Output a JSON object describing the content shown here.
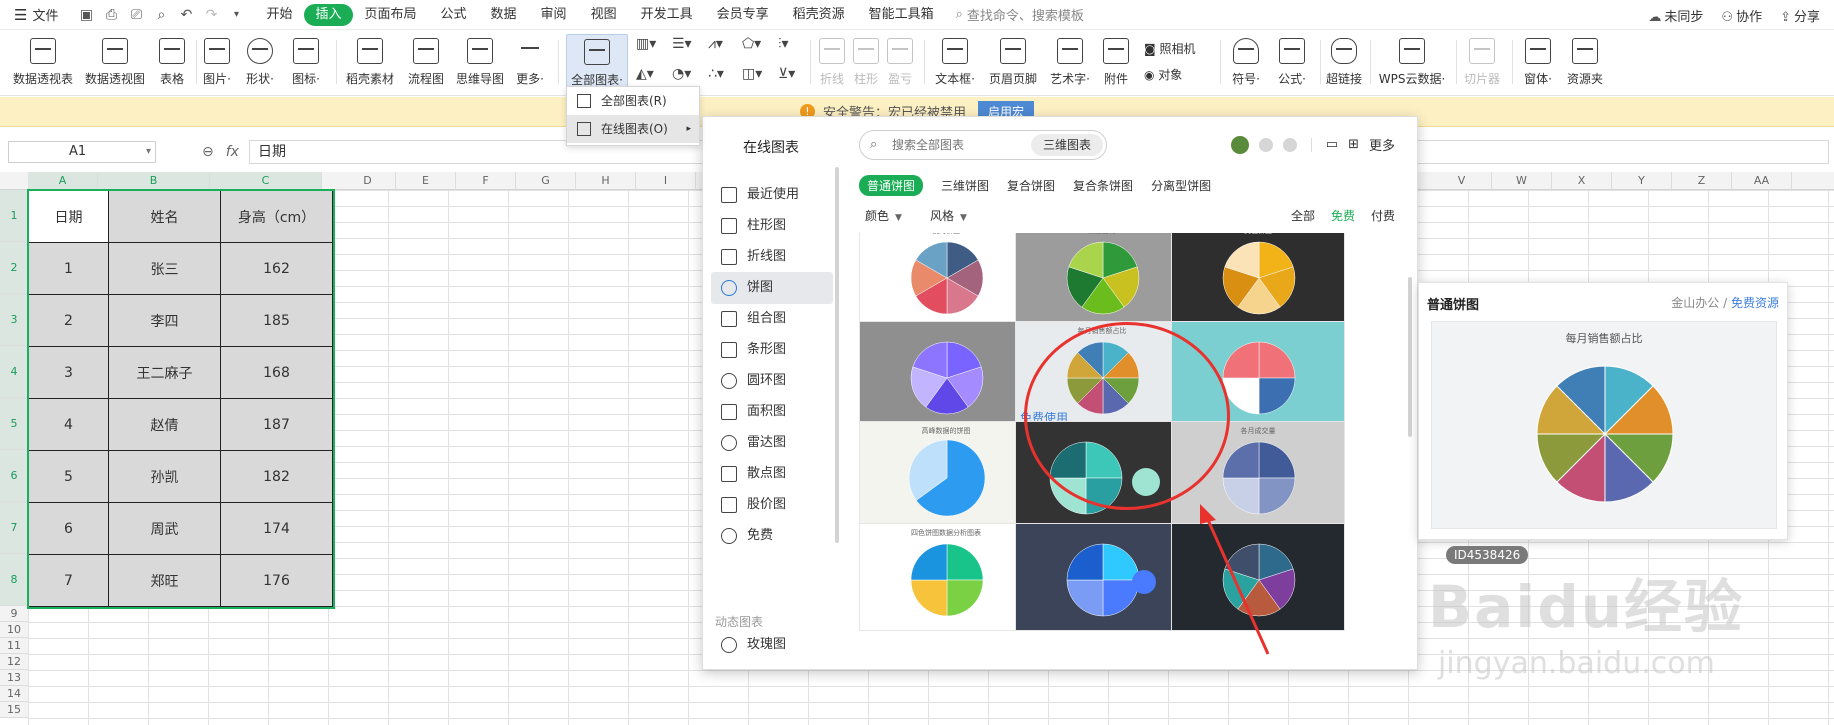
{
  "menubar": {
    "file": "文件",
    "tabs": [
      "开始",
      "插入",
      "页面布局",
      "公式",
      "数据",
      "审阅",
      "视图",
      "开发工具",
      "会员专享",
      "稻壳资源",
      "智能工具箱"
    ],
    "active_tab": "插入",
    "search": "查找命令、搜索模板",
    "sync": "未同步",
    "collab": "协作",
    "share": "分享"
  },
  "ribbon": {
    "pivot_table": "数据透视表",
    "pivot_chart": "数据透视图",
    "table": "表格",
    "picture": "图片·",
    "shape": "形状·",
    "icon": "图标·",
    "docer": "稻壳素材",
    "flowchart": "流程图",
    "mindmap": "思维导图",
    "more": "更多·",
    "all_charts": "全部图表·",
    "spark_line": "折线",
    "spark_bar": "柱形",
    "spark_winloss": "盈亏",
    "textbox": "文本框·",
    "header_footer": "页眉页脚",
    "wordart": "艺术字·",
    "attachment": "附件",
    "camera": "照相机",
    "object": "对象",
    "symbol": "符号·",
    "formula": "公式·",
    "hyperlink": "超链接",
    "wps_cloud": "WPS云数据·",
    "slicer": "切片器",
    "window": "窗体·",
    "resources": "资源夹"
  },
  "warning": {
    "text": "安全警告：宏已经被禁用",
    "button": "启用宏"
  },
  "formula_bar": {
    "cell_ref": "A1",
    "fx": "fx",
    "value": "日期"
  },
  "sheet": {
    "columns": [
      "A",
      "B",
      "C",
      "D",
      "E",
      "F",
      "G",
      "H",
      "I",
      "V",
      "W",
      "X",
      "Y",
      "Z",
      "AA"
    ],
    "rows": [
      "1",
      "2",
      "3",
      "4",
      "5",
      "6",
      "7",
      "8",
      "9",
      "10",
      "11",
      "12",
      "13",
      "14",
      "15"
    ],
    "table": {
      "headers": [
        "日期",
        "姓名",
        "身高（cm）"
      ],
      "rows": [
        [
          "1",
          "张三",
          "162"
        ],
        [
          "2",
          "李四",
          "185"
        ],
        [
          "3",
          "王二麻子",
          "168"
        ],
        [
          "4",
          "赵倩",
          "187"
        ],
        [
          "5",
          "孙凯",
          "182"
        ],
        [
          "6",
          "周武",
          "174"
        ],
        [
          "7",
          "郑旺",
          "176"
        ]
      ]
    }
  },
  "dropdown": {
    "items": [
      "全部图表(R)",
      "在线图表(O)"
    ]
  },
  "online_panel": {
    "title": "在线图表",
    "search_placeholder": "搜索全部图表",
    "three_d": "三维图表",
    "more": "更多",
    "sidebar": [
      "最近使用",
      "柱形图",
      "折线图",
      "饼图",
      "组合图",
      "条形图",
      "圆环图",
      "面积图",
      "雷达图",
      "散点图",
      "股价图",
      "免费"
    ],
    "sidebar_active": "饼图",
    "sidebar_section": "动态图表",
    "sidebar_extra": "玫瑰图",
    "chips": [
      "普通饼图",
      "三维饼图",
      "复合饼图",
      "复合条饼图",
      "分离型饼图"
    ],
    "chip_active": "普通饼图",
    "filters": {
      "color": "颜色",
      "style": "风格"
    },
    "price": [
      "全部",
      "免费",
      "付费"
    ],
    "price_active": "免费",
    "free_badge": "免费使用",
    "thumb_titles": [
      "我的饼图",
      "数量占比",
      "黄色饼图",
      "",
      "每月销售额占比",
      "",
      "高峰数据的饼图",
      "",
      "各月成交量",
      "四色饼图数据分析图表",
      "",
      ""
    ]
  },
  "preview": {
    "title": "普通饼图",
    "source": "金山办公",
    "slash": "/",
    "source_link": "免费资源",
    "chart_title": "每月销售额占比",
    "id": "ID4538426"
  },
  "watermark": {
    "brand": "Baidu经验",
    "url": "jingyan.baidu.com"
  },
  "colors": {
    "accent_green": "#1aad55",
    "selection_green": "#1ab05b",
    "annotation_red": "#e8322e",
    "link_blue": "#3d7fdb"
  }
}
